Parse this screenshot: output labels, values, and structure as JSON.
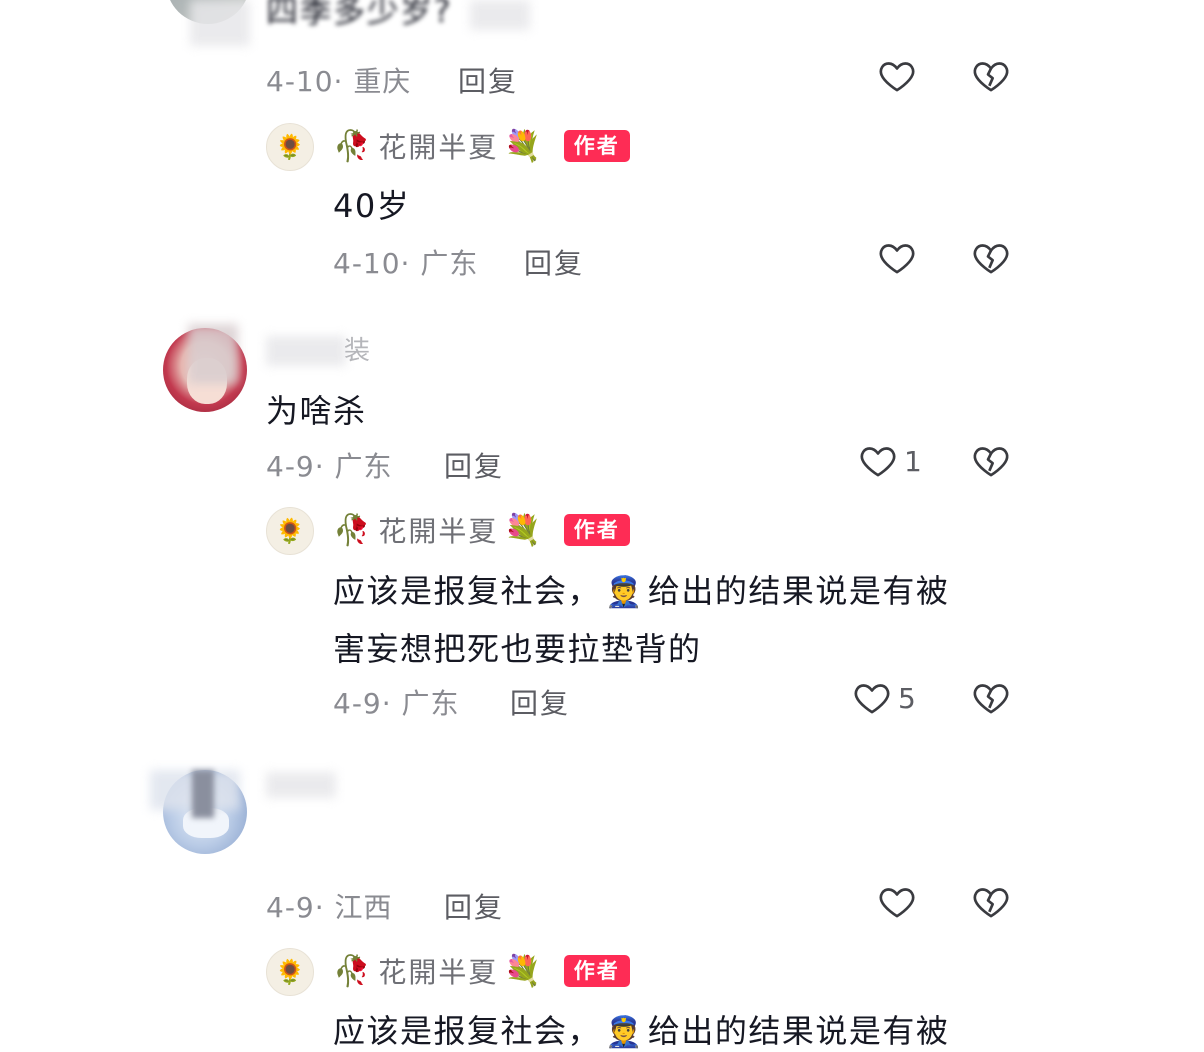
{
  "comments": [
    {
      "text": "四季多少岁?",
      "date": "4-10",
      "location": "重庆",
      "reply_label": "回复",
      "like_count": "",
      "replies": [
        {
          "author": "花開半夏",
          "author_tag": "作者",
          "text_lines": [
            "40岁"
          ],
          "date": "4-10",
          "location": "广东",
          "reply_label": "回复",
          "like_count": ""
        }
      ]
    },
    {
      "author_suffix": "装",
      "text": "为啥杀",
      "date": "4-9",
      "location": "广东",
      "reply_label": "回复",
      "like_count": "1",
      "replies": [
        {
          "author": "花開半夏",
          "author_tag": "作者",
          "text_lines": [
            "应该是报复社会，",
            "给出的结果说是有被",
            "害妄想把死也要拉垫背的"
          ],
          "date": "4-9",
          "location": "广东",
          "reply_label": "回复",
          "like_count": "5"
        }
      ]
    },
    {
      "date": "4-9",
      "location": "江西",
      "reply_label": "回复",
      "like_count": "",
      "replies": [
        {
          "author": "花開半夏",
          "author_tag": "作者",
          "text_lines": [
            "应该是报复社会，",
            "给出的结果说是有被"
          ]
        }
      ]
    }
  ],
  "sep": "·",
  "icons": {
    "like": "heart-outline-icon",
    "dislike": "broken-heart-icon",
    "police": "police-officer-emoji",
    "flower_left": "wilted-rose-emoji",
    "flower_right": "bouquet-emoji",
    "reply_avatar": "sunflower-avatar"
  },
  "colors": {
    "author_tag_bg": "#fe2c55",
    "meta": "#8a8b91",
    "text": "#161823"
  }
}
